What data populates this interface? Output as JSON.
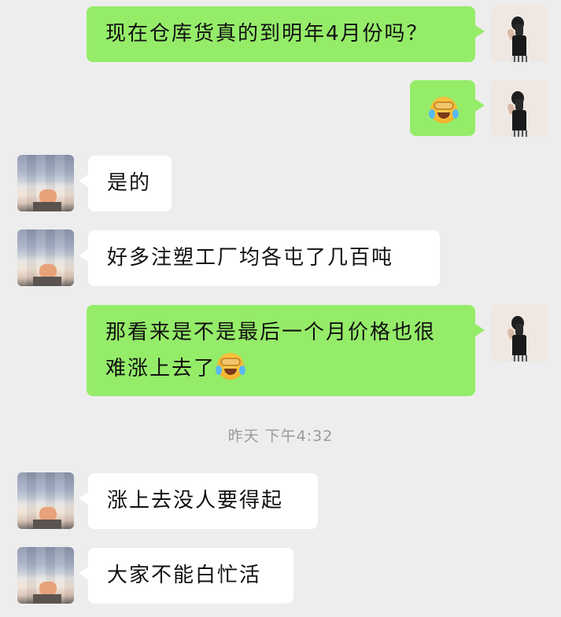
{
  "messages": [
    {
      "from": "me",
      "text": "现在仓库货真的到明年4月份吗？"
    },
    {
      "from": "me",
      "text": "",
      "emoji": "face-palm-crying-emoji"
    },
    {
      "from": "them",
      "text": "是的"
    },
    {
      "from": "them",
      "text": "好多注塑工厂均各屯了几百吨"
    },
    {
      "from": "me",
      "line1": "那看来是不是最后一个月价格也很",
      "line2": "难涨上去了",
      "emoji": "face-palm-crying-emoji"
    },
    {
      "from": "them",
      "text": "涨上去没人要得起"
    },
    {
      "from": "them",
      "text": "大家不能白忙活"
    }
  ],
  "timestamp": "昨天 下午4:32",
  "colors": {
    "background": "#ededed",
    "my_bubble": "#95ec69",
    "their_bubble": "#ffffff",
    "timestamp": "#9a9a9a"
  }
}
